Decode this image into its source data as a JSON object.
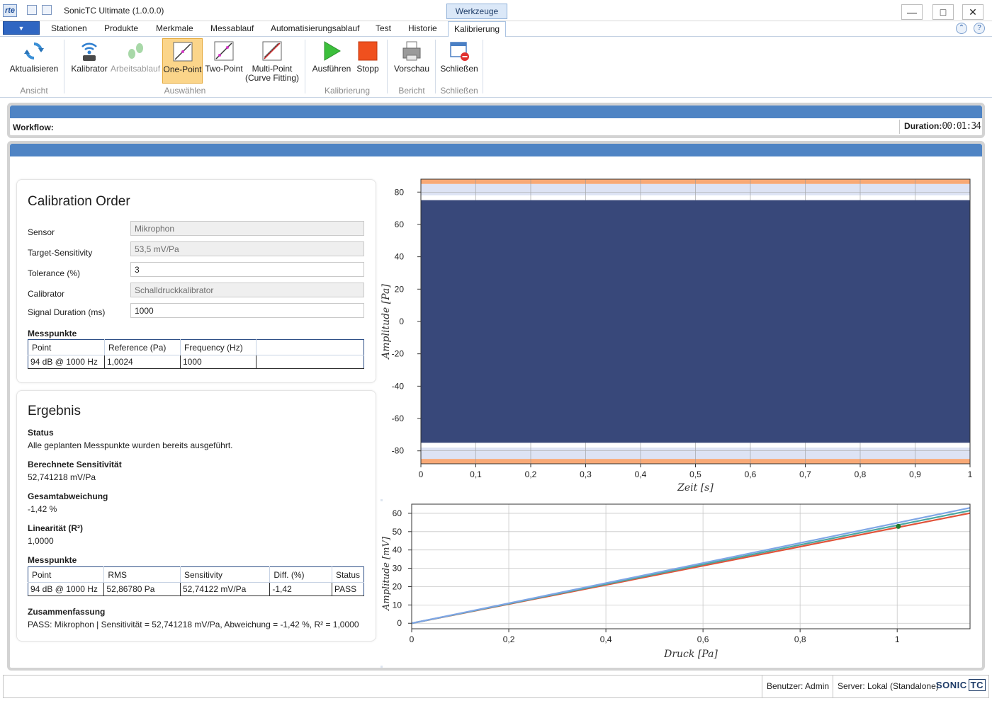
{
  "window": {
    "title": "SonicTC Ultimate (1.0.0.0)",
    "context_tab": "Werkzeuge",
    "minimize": "—",
    "maximize": "□",
    "close": "✕"
  },
  "ribbon": {
    "tabs": [
      "Stationen",
      "Produkte",
      "Merkmale",
      "Messablauf",
      "Automatisierungsablauf",
      "Test",
      "Historie",
      "Kalibrierung"
    ],
    "active_tab": "Kalibrierung",
    "buttons": {
      "refresh": "Aktualisieren",
      "calibrator": "Kalibrator",
      "workflow": "Arbeitsablauf",
      "one_point": "One-Point",
      "two_point": "Two-Point",
      "multi_point_1": "Multi-Point",
      "multi_point_2": "(Curve Fitting)",
      "run": "Ausführen",
      "stop": "Stopp",
      "preview": "Vorschau",
      "close": "Schließen"
    },
    "groups": {
      "view": "Ansicht",
      "select": "Auswählen",
      "calibration": "Kalibrierung",
      "report": "Bericht",
      "close": "Schließen"
    }
  },
  "workflow": {
    "label": "Workflow:",
    "duration_label": "Duration:",
    "duration_value": "00:01:34"
  },
  "calibration_order": {
    "title": "Calibration Order",
    "fields": {
      "sensor_label": "Sensor",
      "sensor_value": "Mikrophon",
      "target_label": "Target-Sensitivity",
      "target_value": "53,5 mV/Pa",
      "tolerance_label": "Tolerance (%)",
      "tolerance_value": "3",
      "calibrator_label": "Calibrator",
      "calibrator_value": "Schalldruckkalibrator",
      "duration_label": "Signal Duration (ms)",
      "duration_value": "1000"
    },
    "messpunkte_title": "Messpunkte",
    "table": {
      "headers": [
        "Point",
        "Reference (Pa)",
        "Frequency (Hz)",
        ""
      ],
      "rows": [
        [
          "94 dB @ 1000 Hz",
          "1,0024",
          "1000",
          ""
        ]
      ]
    }
  },
  "result": {
    "title": "Ergebnis",
    "status_label": "Status",
    "status_value": "Alle geplanten Messpunkte wurden bereits ausgeführt.",
    "sens_label": "Berechnete Sensitivität",
    "sens_value": "52,741218 mV/Pa",
    "dev_label": "Gesamtabweichung",
    "dev_value": "-1,42 %",
    "lin_label": "Linearität (R²)",
    "lin_value": "1,0000",
    "messpunkte_title": "Messpunkte",
    "table": {
      "headers": [
        "Point",
        "RMS",
        "Sensitivity",
        "Diff. (%)",
        "Status"
      ],
      "rows": [
        [
          "94 dB @ 1000 Hz",
          "52,86780 Pa",
          "52,74122 mV/Pa",
          "-1,42",
          "PASS"
        ]
      ]
    },
    "summary_label": "Zusammenfassung",
    "summary_value": "PASS: Mikrophon | Sensitivität = 52,741218 mV/Pa, Abweichung = -1,42 %, R² = 1,0000"
  },
  "chart_data": [
    {
      "type": "area",
      "xlabel": "Zeit [s]",
      "ylabel": "Amplitude [Pa]",
      "xlim": [
        0,
        1
      ],
      "ylim": [
        -88,
        88
      ],
      "xticks": [
        "0",
        "0,1",
        "0,2",
        "0,3",
        "0,4",
        "0,5",
        "0,6",
        "0,7",
        "0,8",
        "0,9",
        "1"
      ],
      "yticks": [
        "80",
        "60",
        "40",
        "20",
        "0",
        "-20",
        "-40",
        "-60",
        "-80"
      ],
      "signal_envelope": [
        -75,
        75
      ],
      "tolerance_band_inner": [
        -78,
        78
      ],
      "tolerance_band_outer": [
        -85,
        85
      ],
      "grid": true,
      "colors": {
        "signal": "#38487a",
        "band_outer": "#f8a976",
        "band_inner": "#dde3f4"
      }
    },
    {
      "type": "line",
      "xlabel": "Druck [Pa]",
      "ylabel": "Amplitude [mV]",
      "xlim": [
        0,
        1.15
      ],
      "ylim": [
        -3,
        65
      ],
      "xticks": [
        "0",
        "0,2",
        "0,4",
        "0,6",
        "0,8",
        "1"
      ],
      "yticks": [
        "60",
        "50",
        "40",
        "30",
        "20",
        "10",
        "0"
      ],
      "series": [
        {
          "color": "#e0533a",
          "points": [
            [
              0,
              0
            ],
            [
              1.15,
              60.1
            ]
          ]
        },
        {
          "color": "#4aa7a0",
          "points": [
            [
              0,
              0
            ],
            [
              1.15,
              61.5
            ]
          ]
        },
        {
          "color": "#7fa6e6",
          "points": [
            [
              0,
              0
            ],
            [
              1.15,
              63.0
            ]
          ]
        }
      ],
      "measured_point": {
        "x": 1.0024,
        "y": 52.87,
        "color": "#1f7a2b"
      },
      "grid": true
    }
  ],
  "statusbar": {
    "user": "Benutzer: Admin",
    "server": "Server: Lokal (Standalone)",
    "brand_1": "SONIC",
    "brand_2": "TC"
  }
}
